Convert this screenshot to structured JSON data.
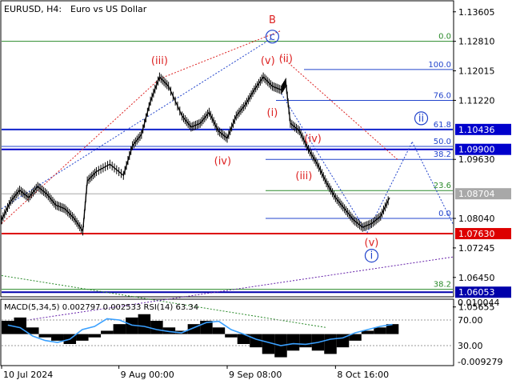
{
  "header": {
    "symbol_tf": "EURUSD, H4:",
    "description": "Euro vs US Dollar",
    "indicator_text": "MACD(5,34,5) 0.002797 0.002533 RSI(14) 63.34"
  },
  "chart_data": {
    "type": "line",
    "title": "EURUSD, H4: Euro vs US Dollar",
    "ylim": [
      1.0595,
      1.1388
    ],
    "y_ticks": [
      "1.13605",
      "1.12810",
      "1.12015",
      "1.11220",
      "1.10436",
      "1.09900",
      "1.09630",
      "1.08704",
      "1.08040",
      "1.07630",
      "1.07245",
      "1.06450",
      "1.06053",
      "1.05655"
    ],
    "x_ticks": [
      "10 Jul 2024",
      "9 Aug 00:00",
      "9 Sep 08:00",
      "8 Oct 16:00"
    ],
    "x_tick_fractions": [
      0.0,
      0.26,
      0.5,
      0.74
    ],
    "close_series": [
      {
        "x": 0.0,
        "y": 1.08
      },
      {
        "x": 0.02,
        "y": 1.085
      },
      {
        "x": 0.04,
        "y": 1.088
      },
      {
        "x": 0.06,
        "y": 1.086
      },
      {
        "x": 0.08,
        "y": 1.089
      },
      {
        "x": 0.1,
        "y": 1.087
      },
      {
        "x": 0.12,
        "y": 1.084
      },
      {
        "x": 0.14,
        "y": 1.083
      },
      {
        "x": 0.16,
        "y": 1.0805
      },
      {
        "x": 0.18,
        "y": 1.077
      },
      {
        "x": 0.19,
        "y": 1.0905
      },
      {
        "x": 0.21,
        "y": 1.093
      },
      {
        "x": 0.24,
        "y": 1.095
      },
      {
        "x": 0.27,
        "y": 1.092
      },
      {
        "x": 0.29,
        "y": 1.1
      },
      {
        "x": 0.31,
        "y": 1.103
      },
      {
        "x": 0.33,
        "y": 1.112
      },
      {
        "x": 0.35,
        "y": 1.1185
      },
      {
        "x": 0.37,
        "y": 1.116
      },
      {
        "x": 0.4,
        "y": 1.108
      },
      {
        "x": 0.42,
        "y": 1.105
      },
      {
        "x": 0.44,
        "y": 1.106
      },
      {
        "x": 0.46,
        "y": 1.109
      },
      {
        "x": 0.48,
        "y": 1.104
      },
      {
        "x": 0.5,
        "y": 1.102
      },
      {
        "x": 0.52,
        "y": 1.108
      },
      {
        "x": 0.54,
        "y": 1.111
      },
      {
        "x": 0.56,
        "y": 1.115
      },
      {
        "x": 0.58,
        "y": 1.1185
      },
      {
        "x": 0.6,
        "y": 1.116
      },
      {
        "x": 0.62,
        "y": 1.115
      },
      {
        "x": 0.63,
        "y": 1.117
      },
      {
        "x": 0.64,
        "y": 1.106
      },
      {
        "x": 0.66,
        "y": 1.104
      },
      {
        "x": 0.68,
        "y": 1.099
      },
      {
        "x": 0.7,
        "y": 1.095
      },
      {
        "x": 0.72,
        "y": 1.09
      },
      {
        "x": 0.74,
        "y": 1.086
      },
      {
        "x": 0.76,
        "y": 1.083
      },
      {
        "x": 0.78,
        "y": 1.08
      },
      {
        "x": 0.8,
        "y": 1.078
      },
      {
        "x": 0.82,
        "y": 1.079
      },
      {
        "x": 0.84,
        "y": 1.081
      },
      {
        "x": 0.86,
        "y": 1.086
      }
    ],
    "horizontal_levels": [
      {
        "label": "1.10436",
        "value": 1.10436,
        "color": "#0000cc"
      },
      {
        "label": "1.09900",
        "value": 1.099,
        "color": "#0000cc"
      },
      {
        "label": "1.07630",
        "value": 1.0763,
        "color": "#dd0000"
      },
      {
        "label": "1.06053",
        "value": 1.06053,
        "color": "#0000aa"
      },
      {
        "label": "1.08704",
        "value": 1.08704,
        "color": "#a8a8a8"
      }
    ],
    "fib_levels": [
      {
        "label": "0.0",
        "value": 1.1281,
        "color": "#2a8a2a"
      },
      {
        "label": "100.0",
        "value": 1.1205,
        "color": "#2244cc"
      },
      {
        "label": "76.0",
        "value": 1.1122,
        "color": "#2244cc"
      },
      {
        "label": "61.8",
        "value": 1.10436,
        "color": "#2244cc"
      },
      {
        "label": "50.0",
        "value": 1.0998,
        "color": "#2244cc"
      },
      {
        "label": "38.2",
        "value": 1.0963,
        "color": "#2244cc"
      },
      {
        "label": "23.6",
        "value": 1.0879,
        "color": "#2a8a2a"
      },
      {
        "label": "0.0",
        "value": 1.0804,
        "color": "#2244cc"
      },
      {
        "label": "38.2",
        "value": 1.0613,
        "color": "#2a8a2a"
      }
    ],
    "wave_labels": [
      {
        "label": "B",
        "x": 0.6,
        "y": 1.133,
        "color": "#dd2222"
      },
      {
        "label": "c",
        "x": 0.6,
        "y": 1.1285,
        "color": "#2244cc",
        "circled": true
      },
      {
        "label": "(iii)",
        "x": 0.35,
        "y": 1.122,
        "color": "#dd2222"
      },
      {
        "label": "(v)",
        "x": 0.59,
        "y": 1.122,
        "color": "#dd2222"
      },
      {
        "label": "(ii)",
        "x": 0.63,
        "y": 1.1225,
        "color": "#dd2222"
      },
      {
        "label": "(i)",
        "x": 0.6,
        "y": 1.108,
        "color": "#dd2222"
      },
      {
        "label": "(iv)",
        "x": 0.49,
        "y": 1.095,
        "color": "#dd2222"
      },
      {
        "label": "(iv)",
        "x": 0.69,
        "y": 1.101,
        "color": "#dd2222"
      },
      {
        "label": "(iii)",
        "x": 0.67,
        "y": 1.091,
        "color": "#dd2222"
      },
      {
        "label": "(v)",
        "x": 0.82,
        "y": 1.073,
        "color": "#dd2222"
      },
      {
        "label": "i",
        "x": 0.82,
        "y": 1.0695,
        "color": "#2244cc",
        "circled": true
      },
      {
        "label": "ii",
        "x": 0.93,
        "y": 1.1065,
        "color": "#2244cc",
        "circled": true
      }
    ],
    "macd_rsi": {
      "y_ticks": [
        "0.010044",
        "70.00",
        "30.00",
        "-0.009279"
      ],
      "ylim_macd": [
        -0.009279,
        0.010044
      ],
      "macd_histogram": [
        0.004,
        0.005,
        0.002,
        -0.001,
        -0.002,
        -0.003,
        -0.002,
        -0.001,
        0.001,
        0.003,
        0.005,
        0.006,
        0.004,
        0.002,
        0.001,
        0.003,
        0.004,
        0.002,
        -0.001,
        -0.003,
        -0.004,
        -0.006,
        -0.007,
        -0.005,
        -0.004,
        -0.005,
        -0.006,
        -0.004,
        -0.002,
        0.001,
        0.002,
        0.003
      ],
      "rsi_series": [
        62,
        58,
        45,
        38,
        35,
        40,
        55,
        60,
        72,
        70,
        62,
        60,
        55,
        52,
        50,
        58,
        66,
        68,
        55,
        48,
        40,
        35,
        30,
        33,
        32,
        35,
        40,
        42,
        50,
        55,
        60,
        63
      ]
    }
  }
}
